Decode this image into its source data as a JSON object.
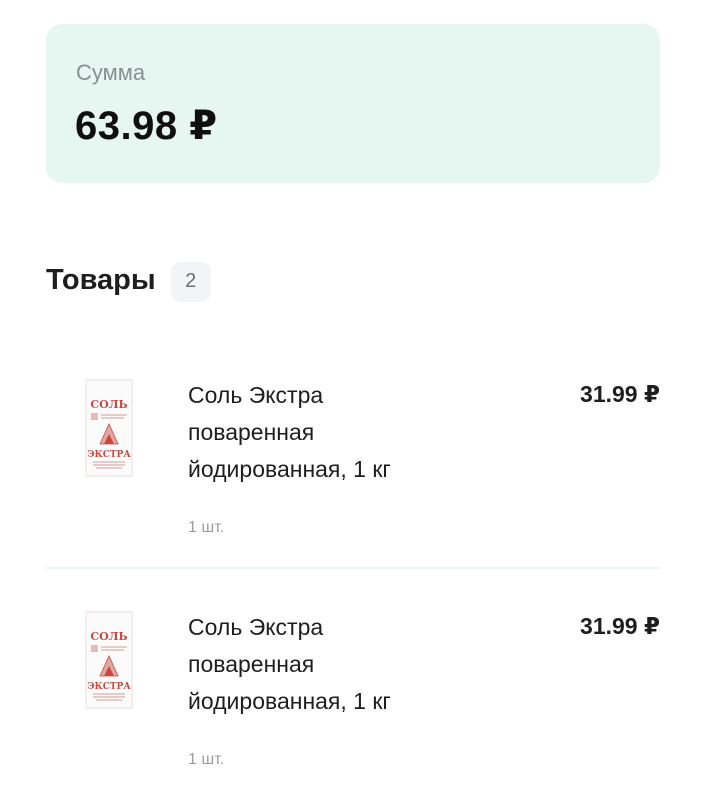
{
  "summary": {
    "label": "Сумма",
    "value": "63.98 ₽"
  },
  "goods": {
    "title": "Товары",
    "count": "2",
    "items": [
      {
        "name": "Соль Экстра поваренная йодированная, 1 кг",
        "price": "31.99 ₽",
        "quantity": "1 шт.",
        "thumb_label_top": "СОЛЬ",
        "thumb_label_bottom": "ЭКСТРА"
      },
      {
        "name": "Соль Экстра поваренная йодированная, 1 кг",
        "price": "31.99 ₽",
        "quantity": "1 шт.",
        "thumb_label_top": "СОЛЬ",
        "thumb_label_bottom": "ЭКСТРА"
      }
    ]
  },
  "colors": {
    "summary_bg": "#e6f6f0",
    "muted_text": "#8a8e93",
    "badge_bg": "#f3f4f6",
    "package_red": "#c9483f"
  }
}
